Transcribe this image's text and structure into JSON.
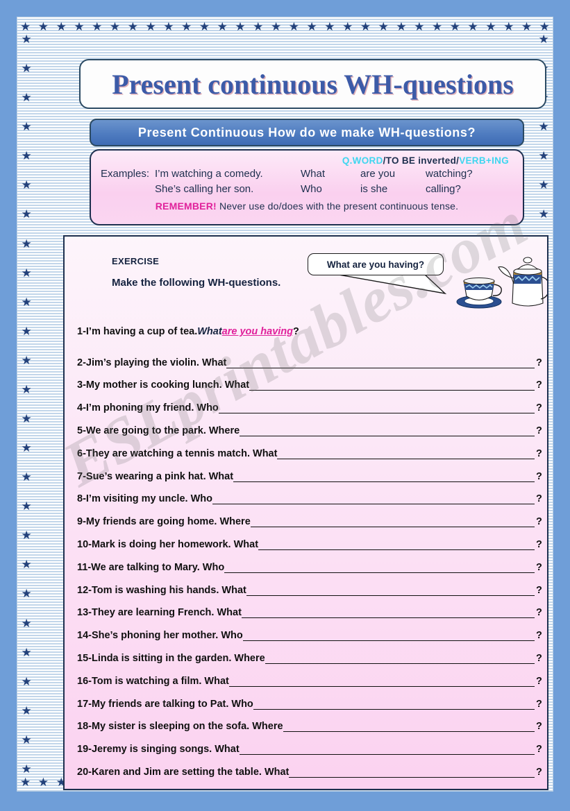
{
  "title": "Present continuous WH-questions",
  "subtitle": "Present Continuous    How do we make WH-questions?",
  "colors": {
    "frame_blue": "#6f9ed8",
    "star_navy": "#23417a",
    "title_blue": "#3c5ba8",
    "bar_blue": "#4f7cc0",
    "pink_box": "#fad0ef",
    "cyan_accent": "#3fd6ef",
    "magenta_accent": "#e0219b",
    "navy_text": "#1d2f4e"
  },
  "example_box": {
    "formula": {
      "part1": "Q.WORD",
      "part2": "/TO BE inverted/",
      "part3": "VERB+ING"
    },
    "label": "Examples:",
    "rows": [
      {
        "sentence": "I’m watching a comedy.",
        "qword": "What",
        "aux": "are you",
        "verb": "watching?"
      },
      {
        "sentence": "She’s calling her son.",
        "qword": "Who",
        "aux": "is she",
        "verb": "calling?"
      }
    ],
    "remember_label": "REMEMBER!",
    "remember_text": "Never use do/does with the present continuous tense."
  },
  "exercise": {
    "label": "EXERCISE",
    "instruction": "Make the following WH-questions.",
    "speech_bubble": "What are you having?",
    "items": [
      {
        "prompt": "1-I’m having a cup of tea. ",
        "answer_qword": "What",
        "answer_fill": "are you having",
        "mark": "?",
        "answered": true
      },
      {
        "prompt": "2-Jim’s playing the violin. What",
        "mark": "?",
        "answered": false
      },
      {
        "prompt": "3-My mother is cooking lunch. What",
        "mark": "?",
        "answered": false
      },
      {
        "prompt": "4-I’m phoning my friend.     Who",
        "mark": "?",
        "answered": false
      },
      {
        "prompt": "5-We are going to the park. Where",
        "mark": "?",
        "answered": false
      },
      {
        "prompt": "6-They are watching a tennis match. What",
        "mark": "?",
        "answered": false
      },
      {
        "prompt": "7-Sue’s wearing a pink hat. What",
        "mark": "?",
        "answered": false
      },
      {
        "prompt": "8-I’m visiting my uncle. Who",
        "mark": "?",
        "answered": false
      },
      {
        "prompt": "9-My friends are going home. Where",
        "mark": "?",
        "answered": false
      },
      {
        "prompt": "10-Mark is doing her homework. What",
        "mark": "?",
        "answered": false
      },
      {
        "prompt": "11-We are talking to Mary. Who",
        "mark": "?",
        "answered": false
      },
      {
        "prompt": "12-Tom is washing his hands. What",
        "mark": "?",
        "answered": false
      },
      {
        "prompt": "13-They are learning French. What",
        "mark": "?",
        "answered": false
      },
      {
        "prompt": "14-She’s phoning her mother. Who",
        "mark": "?",
        "answered": false
      },
      {
        "prompt": "15-Linda is sitting in the garden. Where",
        "mark": "?",
        "answered": false
      },
      {
        "prompt": "16-Tom is watching a film. What",
        "mark": "?",
        "answered": false
      },
      {
        "prompt": "17-My friends are talking to Pat. Who",
        "mark": "?",
        "answered": false
      },
      {
        "prompt": "18-My sister is sleeping on the sofa. Where",
        "mark": "?",
        "answered": false
      },
      {
        "prompt": "19-Jeremy is singing songs. What",
        "mark": "?",
        "answered": false
      },
      {
        "prompt": "20-Karen and Jim are setting the table. What",
        "mark": "?",
        "answered": false
      }
    ]
  },
  "watermark": "ESLprintables.com",
  "decor": {
    "star_glyph": "★",
    "star_count_horizontal": 30,
    "star_count_vertical": 26
  }
}
